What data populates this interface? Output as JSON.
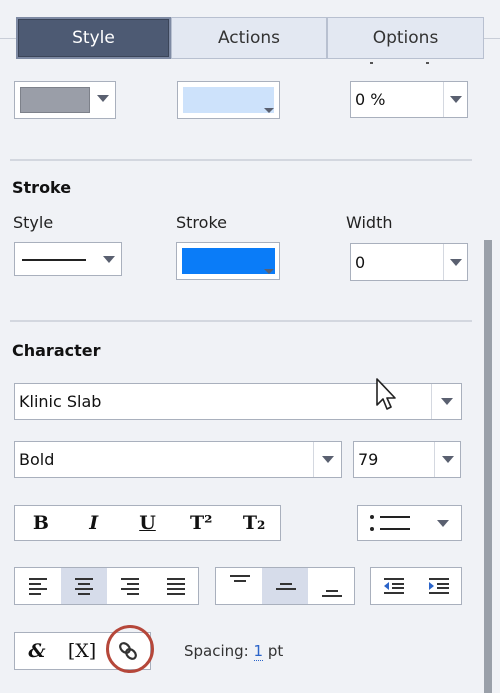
{
  "tabs": [
    {
      "label": "Style",
      "active": true
    },
    {
      "label": "Actions",
      "active": false
    },
    {
      "label": "Options",
      "active": false
    }
  ],
  "fill": {
    "fill_color": "#9a9ea8",
    "gradient_color": "#cde2fb",
    "opacity_value": "0 %"
  },
  "stroke": {
    "title": "Stroke",
    "style_label": "Style",
    "stroke_label": "Stroke",
    "width_label": "Width",
    "stroke_color": "#0a7cf8",
    "width_value": "0"
  },
  "character": {
    "title": "Character",
    "font_family": "Klinic Slab",
    "font_weight": "Bold",
    "font_size": "79",
    "format_buttons": [
      "B",
      "I",
      "U",
      "T²",
      "T₂"
    ],
    "special_buttons": [
      "&",
      "[X]"
    ],
    "spacing_label": "Spacing: ",
    "spacing_value": "1",
    "spacing_unit": " pt"
  },
  "colors": {
    "accent_ring": "#b5473a",
    "active_tab": "#4d5a73"
  }
}
